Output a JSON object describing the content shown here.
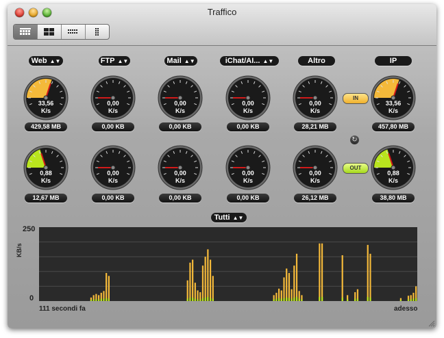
{
  "window": {
    "title": "Traffico"
  },
  "toolbar": {
    "view_buttons": [
      {
        "name": "view-full-button",
        "icon": "grid-wide-icon",
        "active": true
      },
      {
        "name": "view-quad-button",
        "icon": "grid-quad-icon",
        "active": false
      },
      {
        "name": "view-compact-button",
        "icon": "grid-dots-icon",
        "active": false
      },
      {
        "name": "view-list-button",
        "icon": "grid-column-icon",
        "active": false
      }
    ]
  },
  "selectors": {
    "web": "Web",
    "ftp": "FTP",
    "mail": "Mail",
    "ichat": "iChat/AI...",
    "altro": "Altro",
    "ip": "IP",
    "chart_filter": "Tutti"
  },
  "gauges_in": {
    "web": {
      "value": "33,56",
      "unit": "K/s",
      "total": "429,58 MB",
      "level": 0.6
    },
    "ftp": {
      "value": "0,00",
      "unit": "K/s",
      "total": "0,00 KB",
      "level": 0
    },
    "mail": {
      "value": "0,00",
      "unit": "K/s",
      "total": "0,00 KB",
      "level": 0
    },
    "ichat": {
      "value": "0,00",
      "unit": "K/s",
      "total": "0,00 KB",
      "level": 0
    },
    "altro": {
      "value": "0,00",
      "unit": "K/s",
      "total": "28,21 MB",
      "level": 0
    },
    "ip": {
      "value": "33,56",
      "unit": "K/s",
      "total": "457,80 MB",
      "level": 0.6
    }
  },
  "gauges_out": {
    "web": {
      "value": "0,88",
      "unit": "K/s",
      "total": "12,67 MB",
      "level": 0.4
    },
    "ftp": {
      "value": "0,00",
      "unit": "K/s",
      "total": "0,00 KB",
      "level": 0
    },
    "mail": {
      "value": "0,00",
      "unit": "K/s",
      "total": "0,00 KB",
      "level": 0
    },
    "ichat": {
      "value": "0,00",
      "unit": "K/s",
      "total": "0,00 KB",
      "level": 0
    },
    "altro": {
      "value": "0,00",
      "unit": "K/s",
      "total": "26,12 MB",
      "level": 0
    },
    "ip": {
      "value": "0,88",
      "unit": "K/s",
      "total": "38,80 MB",
      "level": 0.4
    }
  },
  "indicators": {
    "in_label": "IN",
    "out_label": "OUT",
    "refresh_icon": "refresh-icon"
  },
  "colors": {
    "in": "#f4b93a",
    "out": "#b9e51e",
    "panel": "#2a2a2a"
  },
  "chart_data": {
    "type": "bar",
    "ylabel": "KB/s",
    "ylim": [
      0,
      250
    ],
    "ytick_labels": [
      "250",
      "0"
    ],
    "x_start_label": "111 secondi fa",
    "x_end_label": "adesso",
    "grid": true,
    "series": [
      {
        "values": [
          0,
          0,
          0,
          0,
          0,
          0,
          0,
          0,
          0,
          0,
          0,
          0,
          0,
          0,
          0,
          0,
          0,
          0,
          0,
          0,
          12,
          20,
          24,
          20,
          28,
          34,
          95,
          85,
          0,
          0,
          0,
          0,
          0,
          0,
          0,
          0,
          0,
          0,
          0,
          0,
          0,
          0,
          0,
          0,
          0,
          0,
          0,
          0,
          0,
          0,
          0,
          0,
          0,
          0,
          0,
          0,
          0,
          0,
          70,
          130,
          140,
          62,
          36,
          30,
          120,
          150,
          175,
          140,
          85,
          0,
          0,
          0,
          0,
          0,
          0,
          0,
          0,
          0,
          0,
          0,
          0,
          0,
          0,
          0,
          0,
          0,
          0,
          0,
          0,
          0,
          0,
          0,
          20,
          28,
          42,
          36,
          80,
          110,
          95,
          40,
          120,
          160,
          34,
          20,
          0,
          0,
          0,
          0,
          0,
          0,
          195,
          195,
          0,
          0,
          0,
          0,
          0,
          0,
          0,
          155,
          0,
          20,
          0,
          0,
          30,
          40,
          0,
          0,
          0,
          190,
          160,
          0,
          0,
          0,
          0,
          0,
          0,
          0,
          0,
          0,
          0,
          0,
          10,
          0,
          0,
          18,
          20,
          28,
          50
        ]
      },
      {
        "values": [
          0,
          0,
          0,
          0,
          0,
          0,
          0,
          0,
          0,
          0,
          0,
          0,
          0,
          0,
          0,
          0,
          0,
          0,
          0,
          0,
          4,
          6,
          6,
          6,
          8,
          8,
          10,
          8,
          0,
          0,
          0,
          0,
          0,
          0,
          0,
          0,
          0,
          0,
          0,
          0,
          0,
          0,
          0,
          0,
          0,
          0,
          0,
          0,
          0,
          0,
          0,
          0,
          0,
          0,
          0,
          0,
          0,
          0,
          8,
          12,
          12,
          8,
          6,
          6,
          10,
          12,
          14,
          10,
          8,
          0,
          0,
          0,
          0,
          0,
          0,
          0,
          0,
          0,
          0,
          0,
          0,
          0,
          0,
          0,
          0,
          0,
          0,
          0,
          0,
          0,
          0,
          0,
          6,
          8,
          10,
          8,
          10,
          12,
          10,
          8,
          12,
          14,
          8,
          6,
          0,
          0,
          0,
          0,
          0,
          0,
          14,
          14,
          0,
          0,
          0,
          0,
          0,
          0,
          0,
          12,
          0,
          6,
          0,
          0,
          8,
          8,
          0,
          0,
          0,
          14,
          12,
          0,
          0,
          0,
          0,
          0,
          0,
          0,
          0,
          0,
          0,
          0,
          4,
          0,
          0,
          6,
          6,
          8,
          10
        ]
      }
    ]
  }
}
